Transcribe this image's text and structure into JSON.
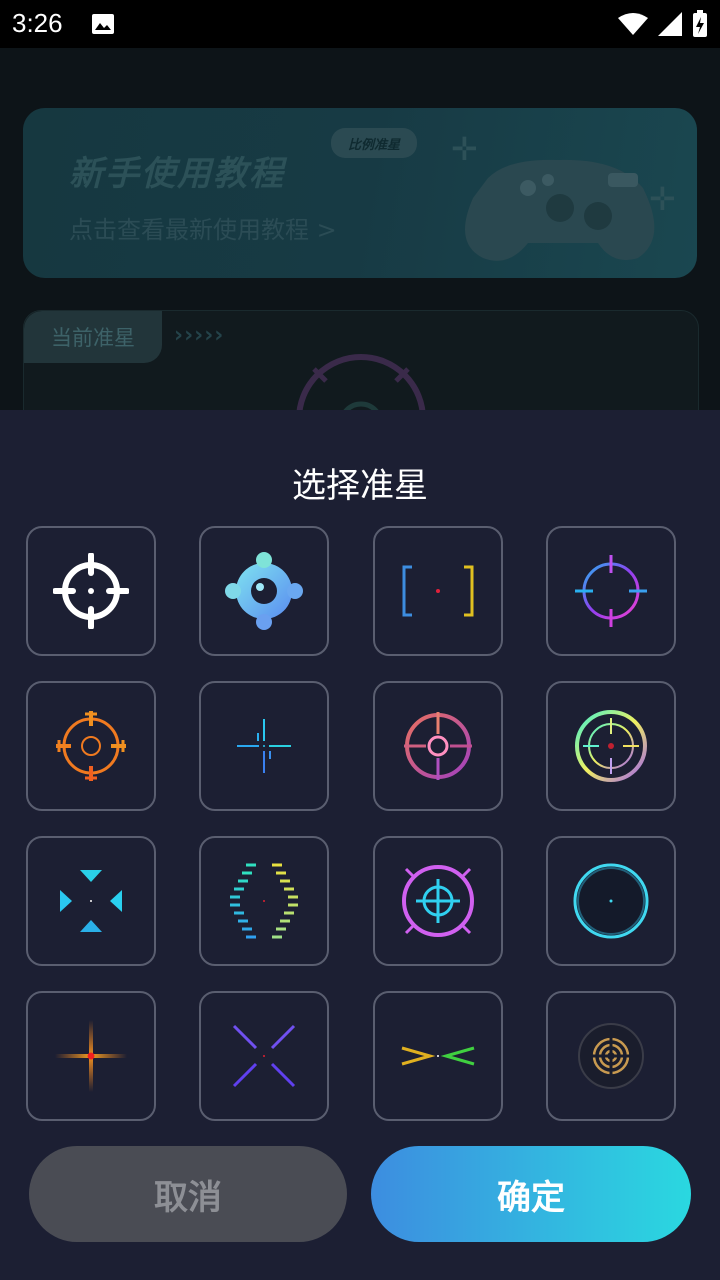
{
  "status_bar": {
    "time": "3:26"
  },
  "banner": {
    "title": "新手使用教程",
    "subtitle": "点击查看最新使用教程 >",
    "bubble": "比例准星"
  },
  "current_crosshair": {
    "label": "当前准星",
    "chevrons": "›››››"
  },
  "sheet": {
    "title": "选择准星"
  },
  "crosshairs": [
    {
      "icon": "white-crosshair-icon"
    },
    {
      "icon": "blue-circle-crosshair-icon"
    },
    {
      "icon": "bracket-crosshair-icon"
    },
    {
      "icon": "purple-ring-crosshair-icon"
    },
    {
      "icon": "orange-ring-crosshair-icon"
    },
    {
      "icon": "blue-cross-crosshair-icon"
    },
    {
      "icon": "pink-ring-crosshair-icon"
    },
    {
      "icon": "gradient-ring-crosshair-icon"
    },
    {
      "icon": "triangle-crosshair-icon"
    },
    {
      "icon": "brace-crosshair-icon"
    },
    {
      "icon": "violet-target-crosshair-icon"
    },
    {
      "icon": "cyan-glow-ring-icon"
    },
    {
      "icon": "orange-star-crosshair-icon"
    },
    {
      "icon": "purple-x-crosshair-icon"
    },
    {
      "icon": "green-chevron-crosshair-icon"
    },
    {
      "icon": "concentric-ring-crosshair-icon"
    }
  ],
  "buttons": {
    "cancel": "取消",
    "confirm": "确定"
  },
  "colors": {
    "sheet_bg": "#1c1f33",
    "confirm_start": "#3d8de0",
    "confirm_end": "#2ad8e0"
  }
}
